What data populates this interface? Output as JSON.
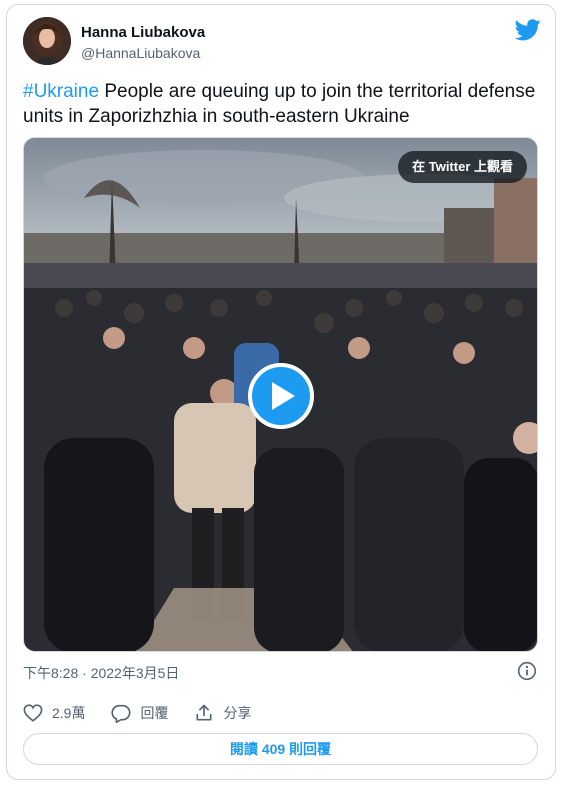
{
  "author": {
    "name": "Hanna Liubakova",
    "handle": "@HannaLiubakova"
  },
  "tweet": {
    "hashtag": "#Ukraine",
    "text": " People are queuing up to join the territorial defense units in Zaporizhzhia in south-eastern Ukraine"
  },
  "media": {
    "watch_on_twitter_label": "在 Twitter 上觀看"
  },
  "meta": {
    "timestamp": "下午8:28 · 2022年3月5日"
  },
  "actions": {
    "likes_count": "2.9萬",
    "reply_label": "回覆",
    "share_label": "分享"
  },
  "replies_button": {
    "prefix": "閱讀 ",
    "count": "409",
    "suffix": " 則回覆"
  },
  "colors": {
    "accent": "#1d9bf0",
    "secondary_text": "#536471",
    "border": "#cfd9de"
  }
}
